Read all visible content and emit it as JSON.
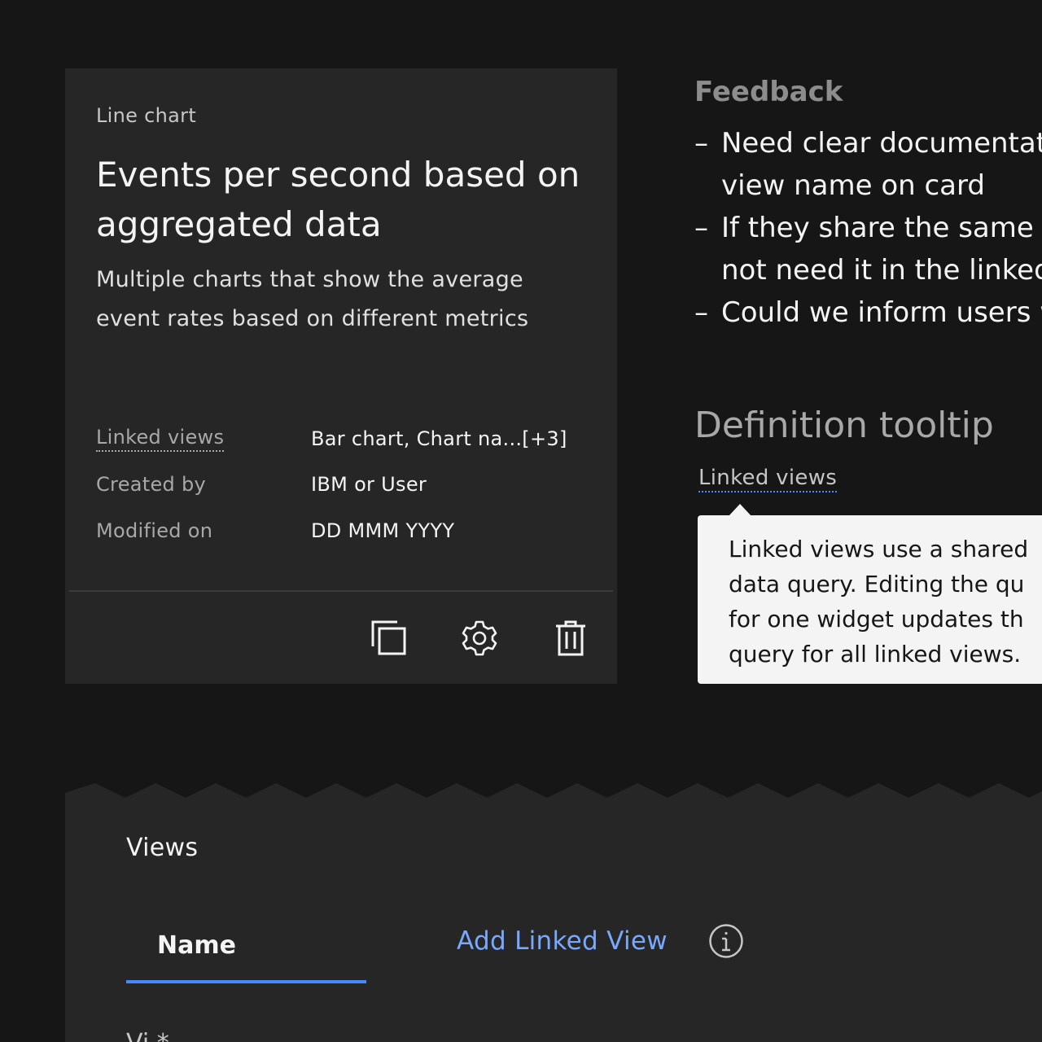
{
  "card": {
    "eyebrow": "Line chart",
    "title": "Events per second based on aggregated data",
    "description": "Multiple charts that show the average event rates based on different metrics",
    "meta": [
      {
        "label": "Linked views",
        "value": "Bar chart, Chart na...[+3]"
      },
      {
        "label": "Created by",
        "value": "IBM or User"
      },
      {
        "label": "Modified on",
        "value": "DD MMM YYYY"
      }
    ],
    "actions": [
      {
        "name": "copy",
        "icon": "copy-icon"
      },
      {
        "name": "settings",
        "icon": "gear-icon"
      },
      {
        "name": "delete",
        "icon": "trash-icon"
      }
    ]
  },
  "feedback": {
    "title": "Feedback",
    "dash": "–",
    "items": [
      "Need clear documentat",
      "view name on card",
      "If they share the same w",
      "not need it in the linked",
      "Could we inform users w"
    ]
  },
  "definition_tooltip": {
    "title": "Definition tooltip",
    "trigger": "Linked views",
    "text": "Linked views use a shared\ndata query. Editing the qu\nfor one widget updates th\nquery for all linked views."
  },
  "views_panel": {
    "heading": "Views",
    "tab_label": "Name",
    "add_link": "Add Linked View",
    "info_icon": "info-icon",
    "partial_label": "Vi         *"
  },
  "colors": {
    "background": "#161616",
    "card": "#262626",
    "accent": "#4589ff",
    "link": "#78a9ff",
    "tooltip_bg": "#f4f4f4"
  }
}
